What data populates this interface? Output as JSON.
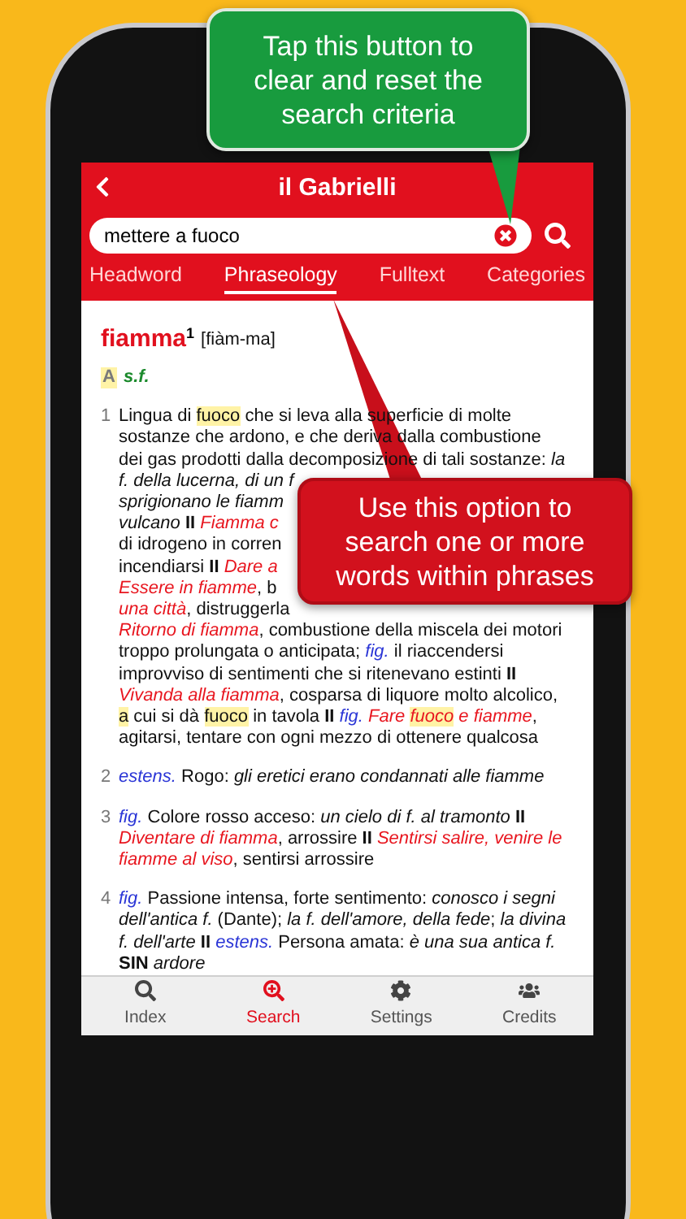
{
  "header": {
    "title": "il Gabrielli"
  },
  "search": {
    "value": "mettere a fuoco"
  },
  "filter_tabs": [
    {
      "label": "Headword",
      "selected": false
    },
    {
      "label": "Phraseology",
      "selected": true
    },
    {
      "label": "Fulltext",
      "selected": false
    },
    {
      "label": "Categories",
      "selected": false
    }
  ],
  "entry": {
    "headword": "fiamma",
    "superscript": "1",
    "pronunciation": "[fiàm-ma]",
    "section": "A",
    "pos": "s.f.",
    "senses": [
      {
        "number": "1",
        "lines": [
          [
            {
              "t": "Lingua di ",
              "kind": "plain"
            },
            {
              "t": "fuoco",
              "kind": "hl"
            },
            {
              "t": " che si leva alla superficie di molte",
              "kind": "plain"
            }
          ],
          [
            {
              "t": "sostanze che ardono, e che deriva dalla combustione",
              "kind": "plain"
            }
          ],
          [
            {
              "t": "dei gas prodotti dalla decomposizione di tali sostanze: ",
              "kind": "plain"
            },
            {
              "t": "la",
              "kind": "ex"
            }
          ],
          [
            {
              "t": "f. della lucerna, di un f",
              "kind": "ex"
            }
          ],
          [
            {
              "t": "sprigionano le fiamm",
              "kind": "ex"
            }
          ],
          [
            {
              "t": "vulcano ",
              "kind": "ex"
            },
            {
              "t": "II ",
              "kind": "bold"
            },
            {
              "t": "Fiamma c",
              "kind": "phrase"
            }
          ],
          [
            {
              "t": "di idrogeno in corren",
              "kind": "plain"
            }
          ],
          [
            {
              "t": "incendiarsi ",
              "kind": "plain"
            },
            {
              "t": "II ",
              "kind": "bold"
            },
            {
              "t": "Dare a",
              "kind": "phrase"
            }
          ],
          [
            {
              "t": "Essere in fiamme",
              "kind": "phrase"
            },
            {
              "t": ", b",
              "kind": "plain"
            }
          ],
          [
            {
              "t": "una città",
              "kind": "phrase"
            },
            {
              "t": ", distruggerla",
              "kind": "plain"
            }
          ],
          [
            {
              "t": "Ritorno di fiamma",
              "kind": "phrase"
            },
            {
              "t": ", combustione della miscela dei motori",
              "kind": "plain"
            }
          ],
          [
            {
              "t": "troppo prolungata o anticipata; ",
              "kind": "plain"
            },
            {
              "t": "fig.",
              "kind": "label"
            },
            {
              "t": " il riaccendersi",
              "kind": "plain"
            }
          ],
          [
            {
              "t": "improvviso di sentimenti che si ritenevano estinti ",
              "kind": "plain"
            },
            {
              "t": "II",
              "kind": "bold"
            }
          ],
          [
            {
              "t": "Vivanda alla fiamma",
              "kind": "phrase"
            },
            {
              "t": ", cosparsa di liquore molto alcolico,",
              "kind": "plain"
            }
          ],
          [
            {
              "t": "a",
              "kind": "hl"
            },
            {
              "t": " cui si dà ",
              "kind": "plain"
            },
            {
              "t": "fuoco",
              "kind": "hl"
            },
            {
              "t": " in tavola ",
              "kind": "plain"
            },
            {
              "t": "II ",
              "kind": "bold"
            },
            {
              "t": "fig. ",
              "kind": "label"
            },
            {
              "t": "Fare ",
              "kind": "phrase"
            },
            {
              "t": "fuoco",
              "kind": "phrase_hl"
            },
            {
              "t": " e fiamme",
              "kind": "phrase"
            },
            {
              "t": ",",
              "kind": "plain"
            }
          ],
          [
            {
              "t": "agitarsi, tentare con ogni mezzo di ottenere qualcosa",
              "kind": "plain"
            }
          ]
        ]
      },
      {
        "number": "2",
        "lines": [
          [
            {
              "t": "estens.",
              "kind": "label"
            },
            {
              "t": " Rogo: ",
              "kind": "plain"
            },
            {
              "t": "gli eretici erano condannati alle fiamme",
              "kind": "ex"
            }
          ]
        ]
      },
      {
        "number": "3",
        "lines": [
          [
            {
              "t": "fig.",
              "kind": "label"
            },
            {
              "t": " Colore rosso acceso: ",
              "kind": "plain"
            },
            {
              "t": "un cielo di f. al tramonto ",
              "kind": "ex"
            },
            {
              "t": "II",
              "kind": "bold"
            }
          ],
          [
            {
              "t": "Diventare di fiamma",
              "kind": "phrase"
            },
            {
              "t": ", arrossire ",
              "kind": "plain"
            },
            {
              "t": "II ",
              "kind": "bold"
            },
            {
              "t": "Sentirsi salire, venire le",
              "kind": "phrase"
            }
          ],
          [
            {
              "t": "fiamme al viso",
              "kind": "phrase"
            },
            {
              "t": ", sentirsi arrossire",
              "kind": "plain"
            }
          ]
        ]
      },
      {
        "number": "4",
        "lines": [
          [
            {
              "t": "fig.",
              "kind": "label"
            },
            {
              "t": " Passione intensa, forte sentimento: ",
              "kind": "plain"
            },
            {
              "t": "conosco i segni",
              "kind": "ex"
            }
          ],
          [
            {
              "t": "dell'antica f.",
              "kind": "ex"
            },
            {
              "t": " (Dante); ",
              "kind": "plain"
            },
            {
              "t": "la f. dell'amore, della fede",
              "kind": "ex"
            },
            {
              "t": "; ",
              "kind": "plain"
            },
            {
              "t": "la divina",
              "kind": "ex"
            }
          ],
          [
            {
              "t": "f. dell'arte ",
              "kind": "ex"
            },
            {
              "t": "II ",
              "kind": "bold"
            },
            {
              "t": "estens.",
              "kind": "label"
            },
            {
              "t": " Persona amata: ",
              "kind": "plain"
            },
            {
              "t": "è una sua antica f.",
              "kind": "ex"
            }
          ],
          [
            {
              "t": "SIN ",
              "kind": "bold"
            },
            {
              "t": "ardore",
              "kind": "ex"
            }
          ]
        ]
      }
    ]
  },
  "bottom_tabs": [
    {
      "label": "Index",
      "selected": false
    },
    {
      "label": "Search",
      "selected": true
    },
    {
      "label": "Settings",
      "selected": false
    },
    {
      "label": "Credits",
      "selected": false
    }
  ],
  "callouts": [
    {
      "kind": "green",
      "text": "Tap this button to clear and reset the search criteria"
    },
    {
      "kind": "red",
      "text": "Use this option to search one or more words within phrases"
    }
  ]
}
